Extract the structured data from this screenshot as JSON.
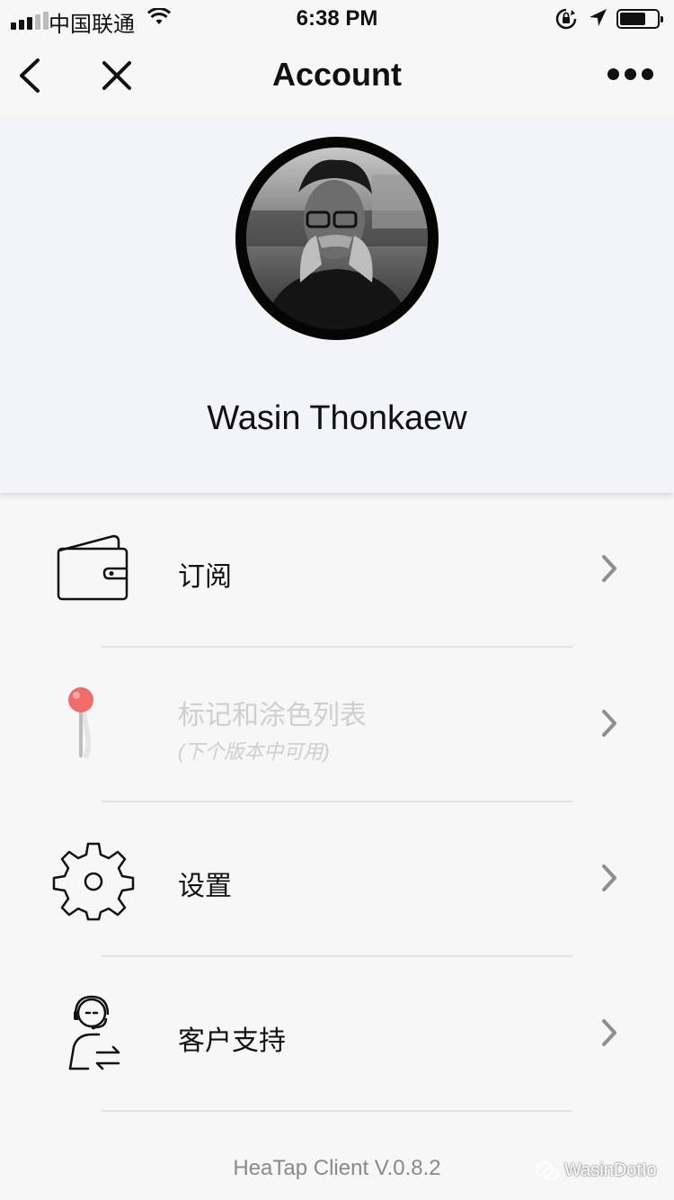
{
  "status_bar": {
    "carrier": "中国联通",
    "time": "6:38 PM"
  },
  "nav": {
    "title": "Account",
    "icons": [
      "back-chevron-icon",
      "close-icon",
      "more-dots-icon"
    ]
  },
  "profile": {
    "name": "Wasin Thonkaew"
  },
  "menu": {
    "items": [
      {
        "label": "订阅",
        "icon": "wallet-icon"
      },
      {
        "label": "标记和涂色列表",
        "sublabel": "(下个版本中可用)",
        "icon": "pin-icon",
        "disabled": true
      },
      {
        "label": "设置",
        "icon": "gear-icon"
      },
      {
        "label": "客户支持",
        "icon": "support-agent-icon"
      }
    ]
  },
  "footer": {
    "version": "HeaTap Client V.0.8.2",
    "watermark": "WasinDotIo"
  },
  "colors": {
    "background": "#f7f7f7",
    "header_bg": "#f3f4f9",
    "pin_red": "#f26b6b",
    "disabled_text": "#cfcfcf",
    "chevron": "#8e8e93"
  }
}
